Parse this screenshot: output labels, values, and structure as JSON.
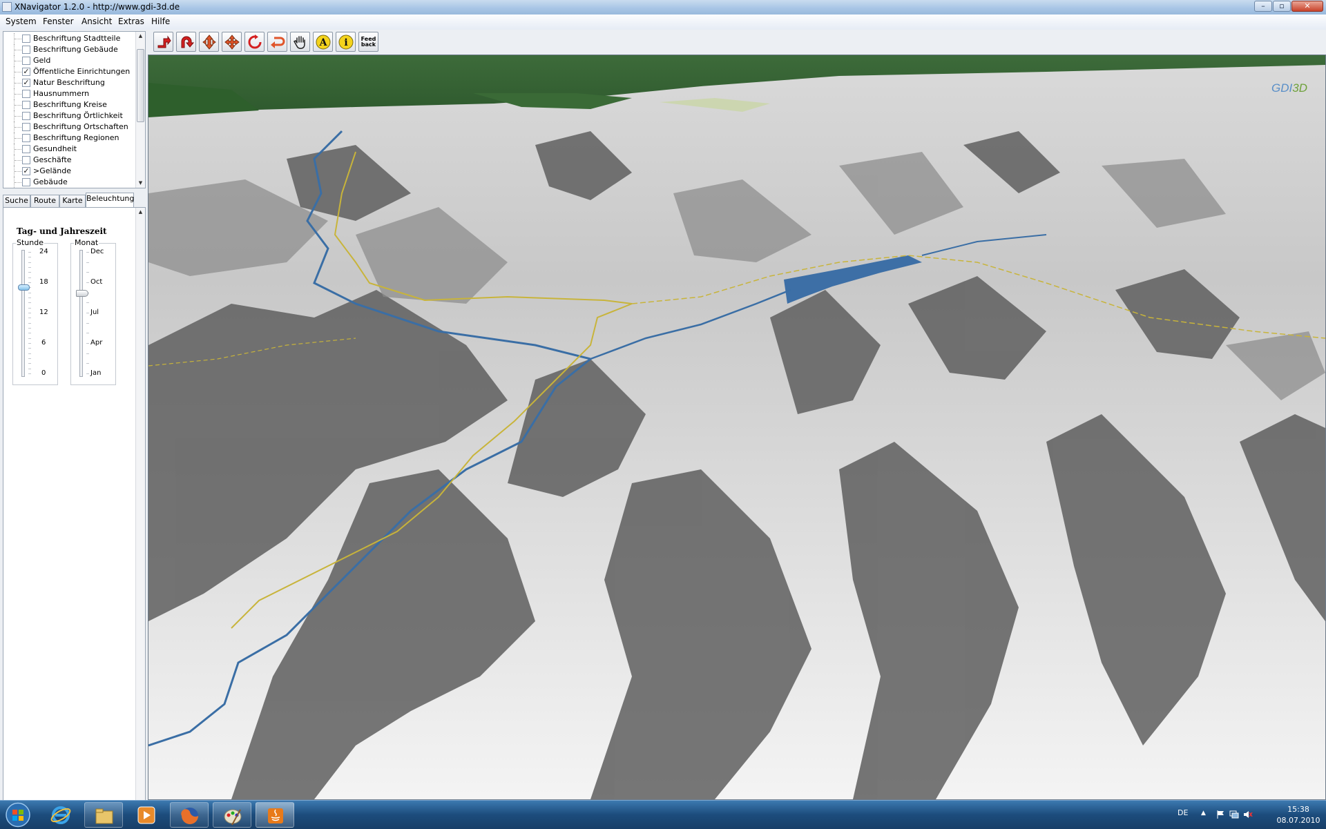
{
  "window": {
    "title": "XNavigator 1.2.0 - http://www.gdi-3d.de"
  },
  "menu": [
    "System",
    "Fenster",
    "Ansicht",
    "Extras",
    "Hilfe"
  ],
  "layers": [
    {
      "label": "Beschriftung Stadtteile",
      "checked": false
    },
    {
      "label": "Beschriftung Gebäude",
      "checked": false
    },
    {
      "label": "Geld",
      "checked": false
    },
    {
      "label": "Öffentliche Einrichtungen",
      "checked": true
    },
    {
      "label": "Natur Beschriftung",
      "checked": true
    },
    {
      "label": "Hausnummern",
      "checked": false
    },
    {
      "label": "Beschriftung Kreise",
      "checked": false
    },
    {
      "label": "Beschriftung Örtlichkeit",
      "checked": false
    },
    {
      "label": "Beschriftung Ortschaften",
      "checked": false
    },
    {
      "label": "Beschriftung Regionen",
      "checked": false
    },
    {
      "label": "Gesundheit",
      "checked": false
    },
    {
      "label": "Geschäfte",
      "checked": false
    },
    {
      "label": ">Gelände",
      "checked": true
    },
    {
      "label": "Gebäude",
      "checked": false
    }
  ],
  "tabs": [
    {
      "label": "Suche",
      "active": false
    },
    {
      "label": "Route",
      "active": false
    },
    {
      "label": "Karte",
      "active": false
    },
    {
      "label": "Beleuchtung",
      "active": true
    }
  ],
  "lighting": {
    "title": "Tag- und Jahreszeit",
    "hour": {
      "label": "Stunde",
      "ticks": [
        "24",
        "18",
        "12",
        "6",
        "0"
      ],
      "min": 0,
      "max": 24,
      "value": 17
    },
    "month": {
      "label": "Monat",
      "ticks": [
        "Dec",
        "Oct",
        "Jul",
        "Apr",
        "Jan"
      ],
      "value_label": "Sep",
      "value_fraction": 0.66
    }
  },
  "toolbar": {
    "buttons": [
      {
        "icon": "tilt-icon"
      },
      {
        "icon": "rotate-icon"
      },
      {
        "icon": "move-updown-icon"
      },
      {
        "icon": "move-icon"
      },
      {
        "icon": "reset-rotation-icon"
      },
      {
        "icon": "undo-icon"
      },
      {
        "icon": "pan-hand-icon"
      },
      {
        "icon": "annotation-icon"
      },
      {
        "icon": "info-icon"
      },
      {
        "icon": "feedback-icon",
        "label": "Feed back"
      }
    ]
  },
  "map": {
    "logo": "GDI",
    "logo_suffix": "3D",
    "river_color": "#3a6ea5",
    "border_color": "#c8b43a"
  },
  "taskbar": {
    "language": "DE",
    "time": "15:38",
    "date": "08.07.2010",
    "apps": [
      "internet-explorer-icon",
      "explorer-folder-icon",
      "media-player-icon",
      "firefox-icon",
      "paint-icon",
      "java-icon"
    ]
  }
}
